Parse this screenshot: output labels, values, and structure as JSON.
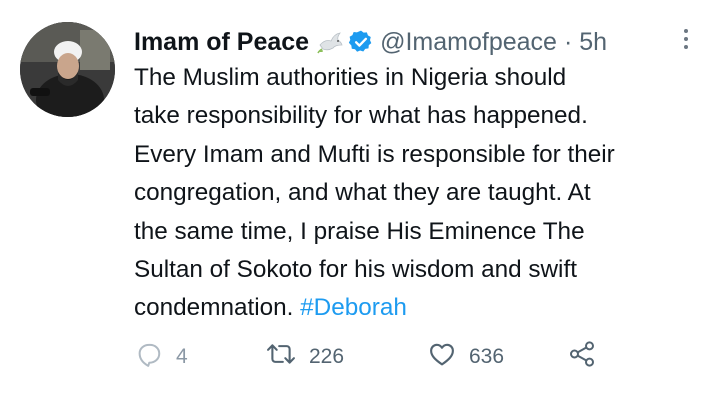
{
  "tweet": {
    "author_name": "Imam of Peace",
    "handle": "@Imamofpeace",
    "separator": "·",
    "time": "5h",
    "text_lines": [
      "The Muslim authorities in Nigeria should",
      "take responsibility for what has happened.",
      "Every Imam and Mufti is responsible for their",
      "congregation, and what they are taught. At",
      "the same time, I praise His Eminence The",
      "Sultan of Sokoto for his wisdom and swift",
      "condemnation."
    ],
    "hashtag": "#Deborah",
    "replies": "4",
    "retweets": "226",
    "likes": "636"
  },
  "icons": {
    "name_emoji": "dove-icon",
    "verified": "verified-badge-icon",
    "more": "more-options-icon",
    "reply": "reply-icon",
    "retweet": "retweet-icon",
    "like": "heart-icon",
    "share": "share-icon"
  },
  "colors": {
    "text": "#0f1419",
    "secondary": "#536471",
    "accent": "#1d9bf0"
  }
}
